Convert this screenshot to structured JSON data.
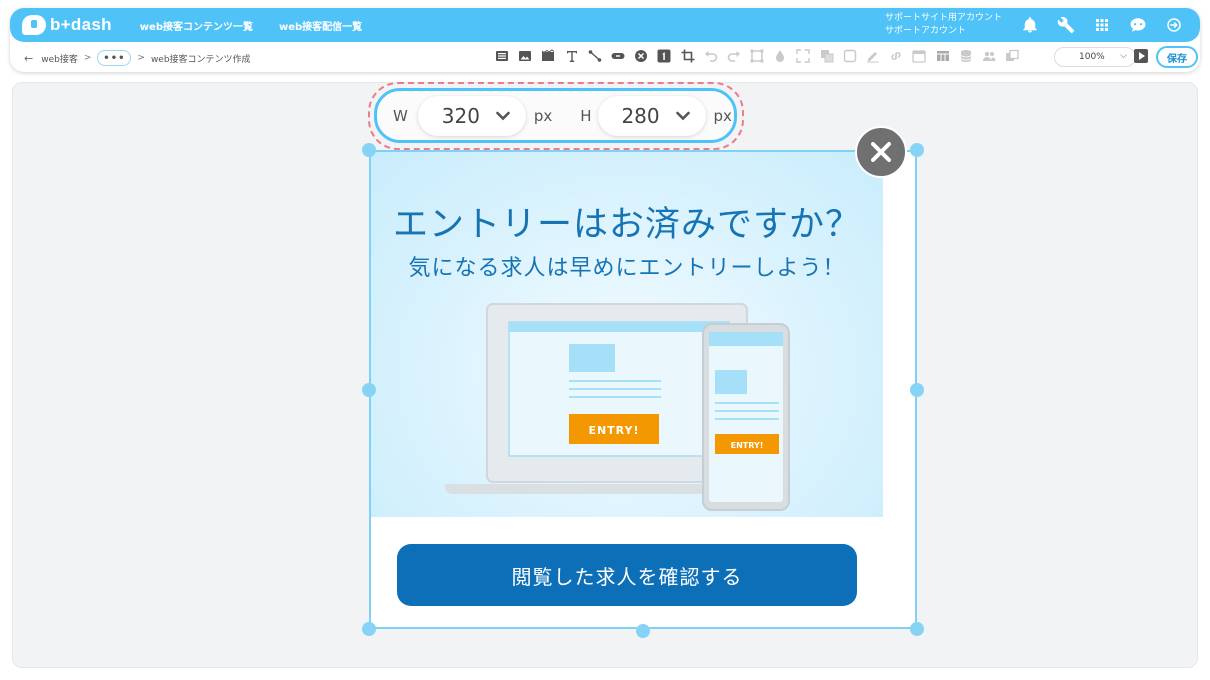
{
  "header": {
    "logo": "b+dash",
    "nav": [
      "web接客コンテンツ一覧",
      "web接客配信一覧"
    ],
    "account_line1": "サポートサイト用アカウント",
    "account_line2": "サポートアカウント",
    "icons": [
      "bell-icon",
      "wrench-icon",
      "grid-icon",
      "chat-bot-icon",
      "logout-icon"
    ]
  },
  "breadcrumb": {
    "back": "←",
    "root": "web接客",
    "sep": ">",
    "more": "•••",
    "current": "web接客コンテンツ作成"
  },
  "toolbar": {
    "zoom": "100%",
    "save_label": "保存",
    "tools": [
      "list-icon",
      "image-icon",
      "video-icon",
      "text-icon",
      "line-icon",
      "button-icon",
      "close-element-icon",
      "number-icon",
      "crop-icon",
      "undo-icon",
      "redo-icon",
      "frame-icon",
      "drop-icon",
      "expand-icon",
      "layer-icon",
      "square-icon",
      "pen-icon",
      "link-icon",
      "calendar-icon",
      "table-icon",
      "database-icon",
      "users-icon",
      "copy-icon"
    ]
  },
  "size_panel": {
    "width_label": "W",
    "width_value": "320",
    "height_label": "H",
    "height_value": "280",
    "unit": "px"
  },
  "popup": {
    "title": "エントリーはお済みですか？",
    "subtitle": "気になる求人は早めにエントリーしよう！",
    "laptop_button": "ENTRY!",
    "phone_button": "ENTRY!",
    "cta": "閲覧した求人を確認する"
  },
  "colors": {
    "brand": "#4fc3f7",
    "cta": "#0d6fb8",
    "title_text": "#1674b4",
    "entry_orange": "#f39800",
    "highlight_dash": "#f07a8a"
  }
}
